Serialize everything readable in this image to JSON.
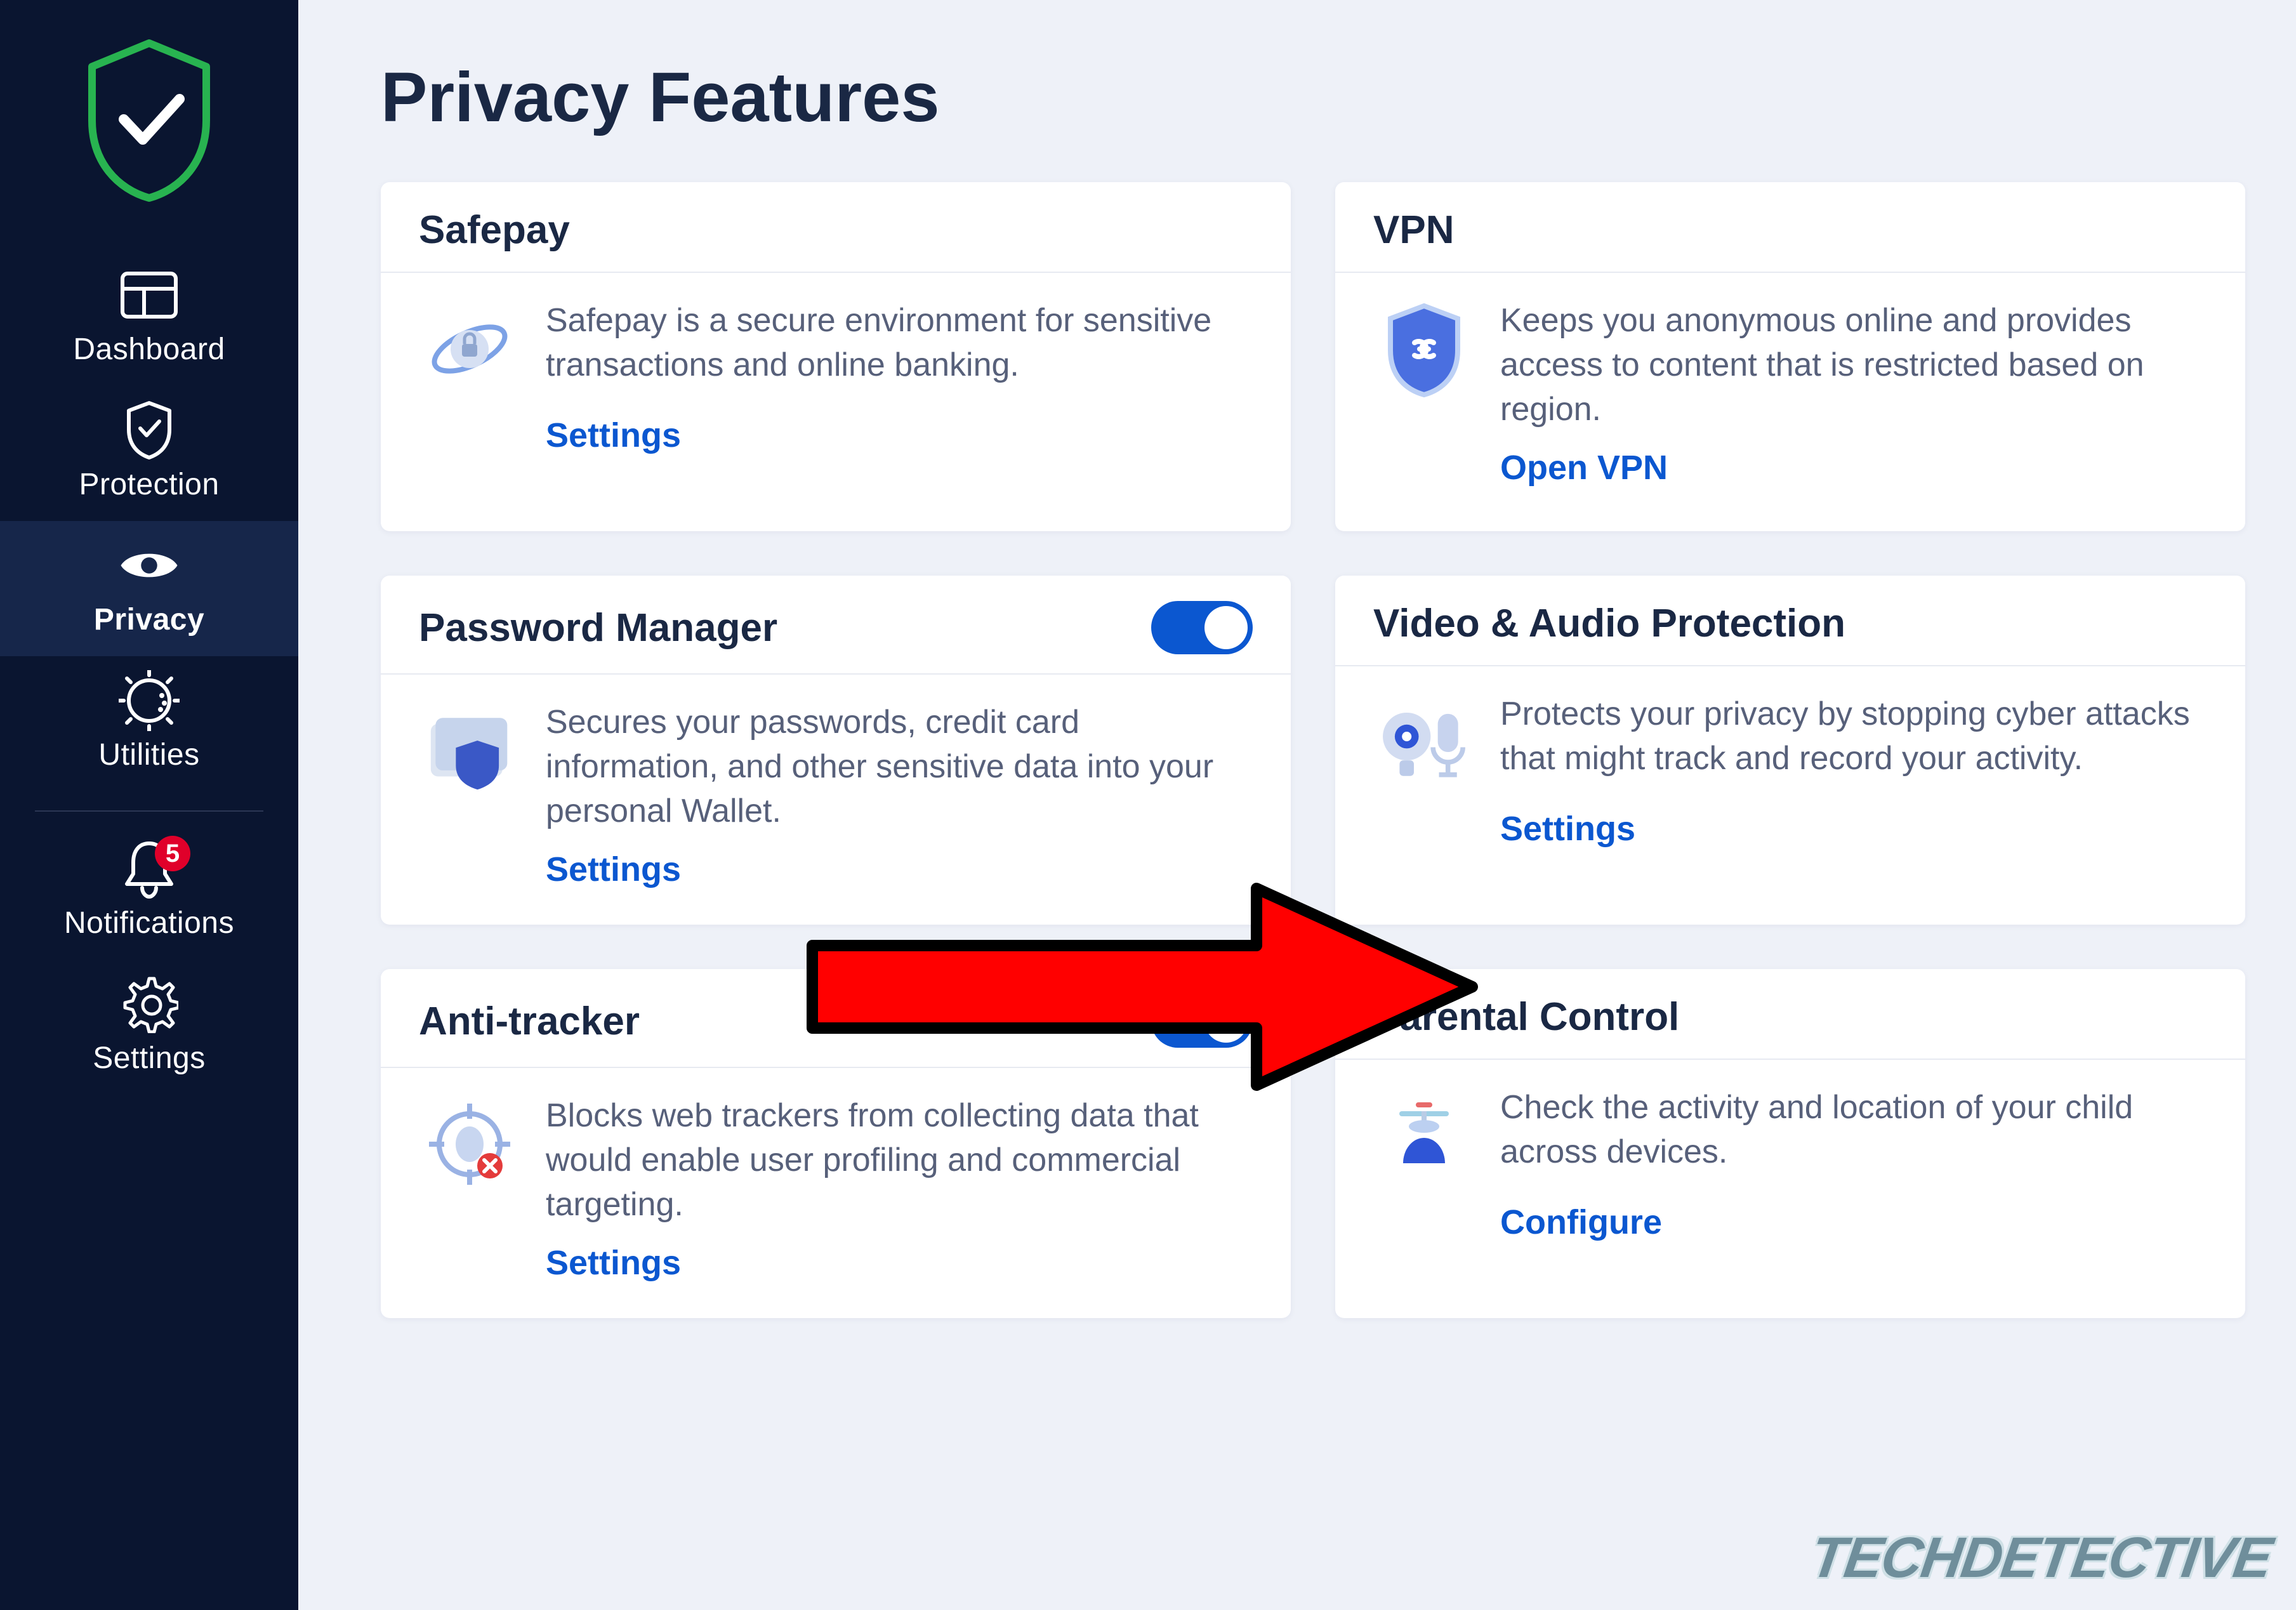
{
  "app": {
    "page_title": "Privacy Features"
  },
  "sidebar": {
    "items": [
      {
        "id": "dashboard",
        "label": "Dashboard",
        "icon": "dashboard",
        "active": false
      },
      {
        "id": "protection",
        "label": "Protection",
        "icon": "shield-check",
        "active": false
      },
      {
        "id": "privacy",
        "label": "Privacy",
        "icon": "eye",
        "active": true
      },
      {
        "id": "utilities",
        "label": "Utilities",
        "icon": "gear-clock",
        "active": false
      }
    ],
    "items_bottom": [
      {
        "id": "notifications",
        "label": "Notifications",
        "icon": "bell",
        "badge": "5"
      },
      {
        "id": "settings",
        "label": "Settings",
        "icon": "gear"
      }
    ]
  },
  "cards": {
    "safepay": {
      "title": "Safepay",
      "description": "Safepay is a secure environment for sensitive transactions and online banking.",
      "action": "Settings",
      "toggle": null
    },
    "vpn": {
      "title": "VPN",
      "description": "Keeps you anonymous online and provides access to content that is restricted based on region.",
      "action": "Open VPN",
      "toggle": null
    },
    "password_manager": {
      "title": "Password Manager",
      "description": "Secures your passwords, credit card information, and other sensitive data into your personal Wallet.",
      "action": "Settings",
      "toggle": true
    },
    "video_audio": {
      "title": "Video & Audio Protection",
      "description": "Protects your privacy by stopping cyber attacks that might track and record your activity.",
      "action": "Settings",
      "toggle": null
    },
    "anti_tracker": {
      "title": "Anti-tracker",
      "description": "Blocks web trackers from collecting data that would enable user profiling and commercial targeting.",
      "action": "Settings",
      "toggle": true
    },
    "parental": {
      "title": "Parental Control",
      "description": "Check the activity and location of your child across devices.",
      "action": "Configure",
      "toggle": null
    }
  },
  "overlay": {
    "arrow_target": "video_audio.settings",
    "arrow_color": "#ff0000"
  },
  "watermark": "TECHDETECTIVE"
}
